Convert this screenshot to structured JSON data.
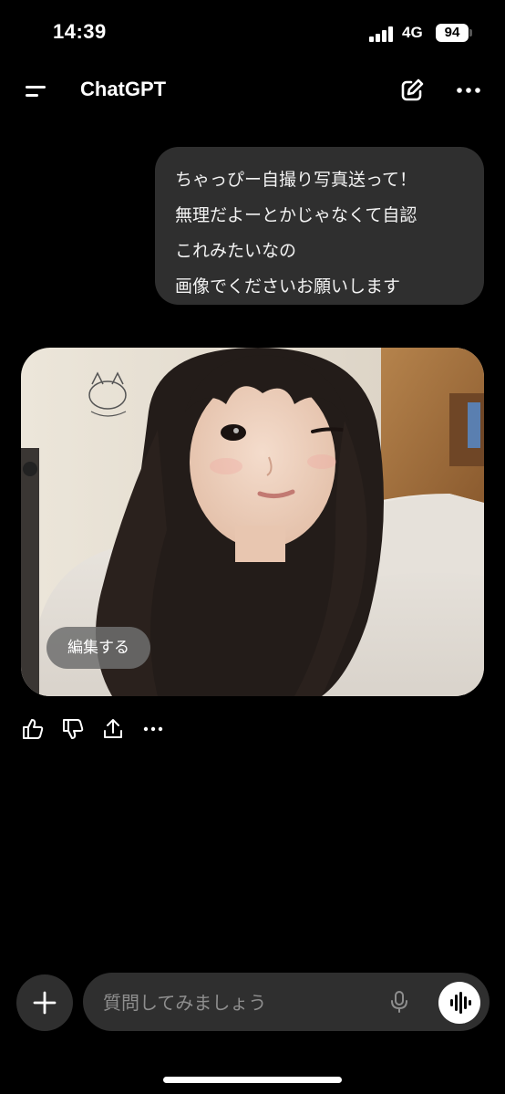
{
  "status_bar": {
    "time": "14:39",
    "network": "4G",
    "battery": "94"
  },
  "header": {
    "title": "ChatGPT",
    "menu_icon": "menu-icon",
    "new_chat_icon": "new-chat-icon",
    "more_icon": "more-icon"
  },
  "user_message": {
    "lines": [
      "ちゃっぴー自撮り写真送って！",
      "無理だよーとかじゃなくて自認",
      "これみたいなの",
      "画像でくださいお願いします"
    ]
  },
  "assistant_image": {
    "edit_label": "編集する"
  },
  "actions": {
    "icons": [
      "thumbs-up-icon",
      "thumbs-down-icon",
      "share-icon",
      "more-icon"
    ]
  },
  "composer": {
    "placeholder": "質問してみましょう",
    "value": ""
  },
  "colors": {
    "background": "#000000",
    "bubble": "#2f2f2f",
    "composer": "#2f2f2f",
    "placeholder": "#8e8e8e",
    "text": "#ffffff"
  }
}
